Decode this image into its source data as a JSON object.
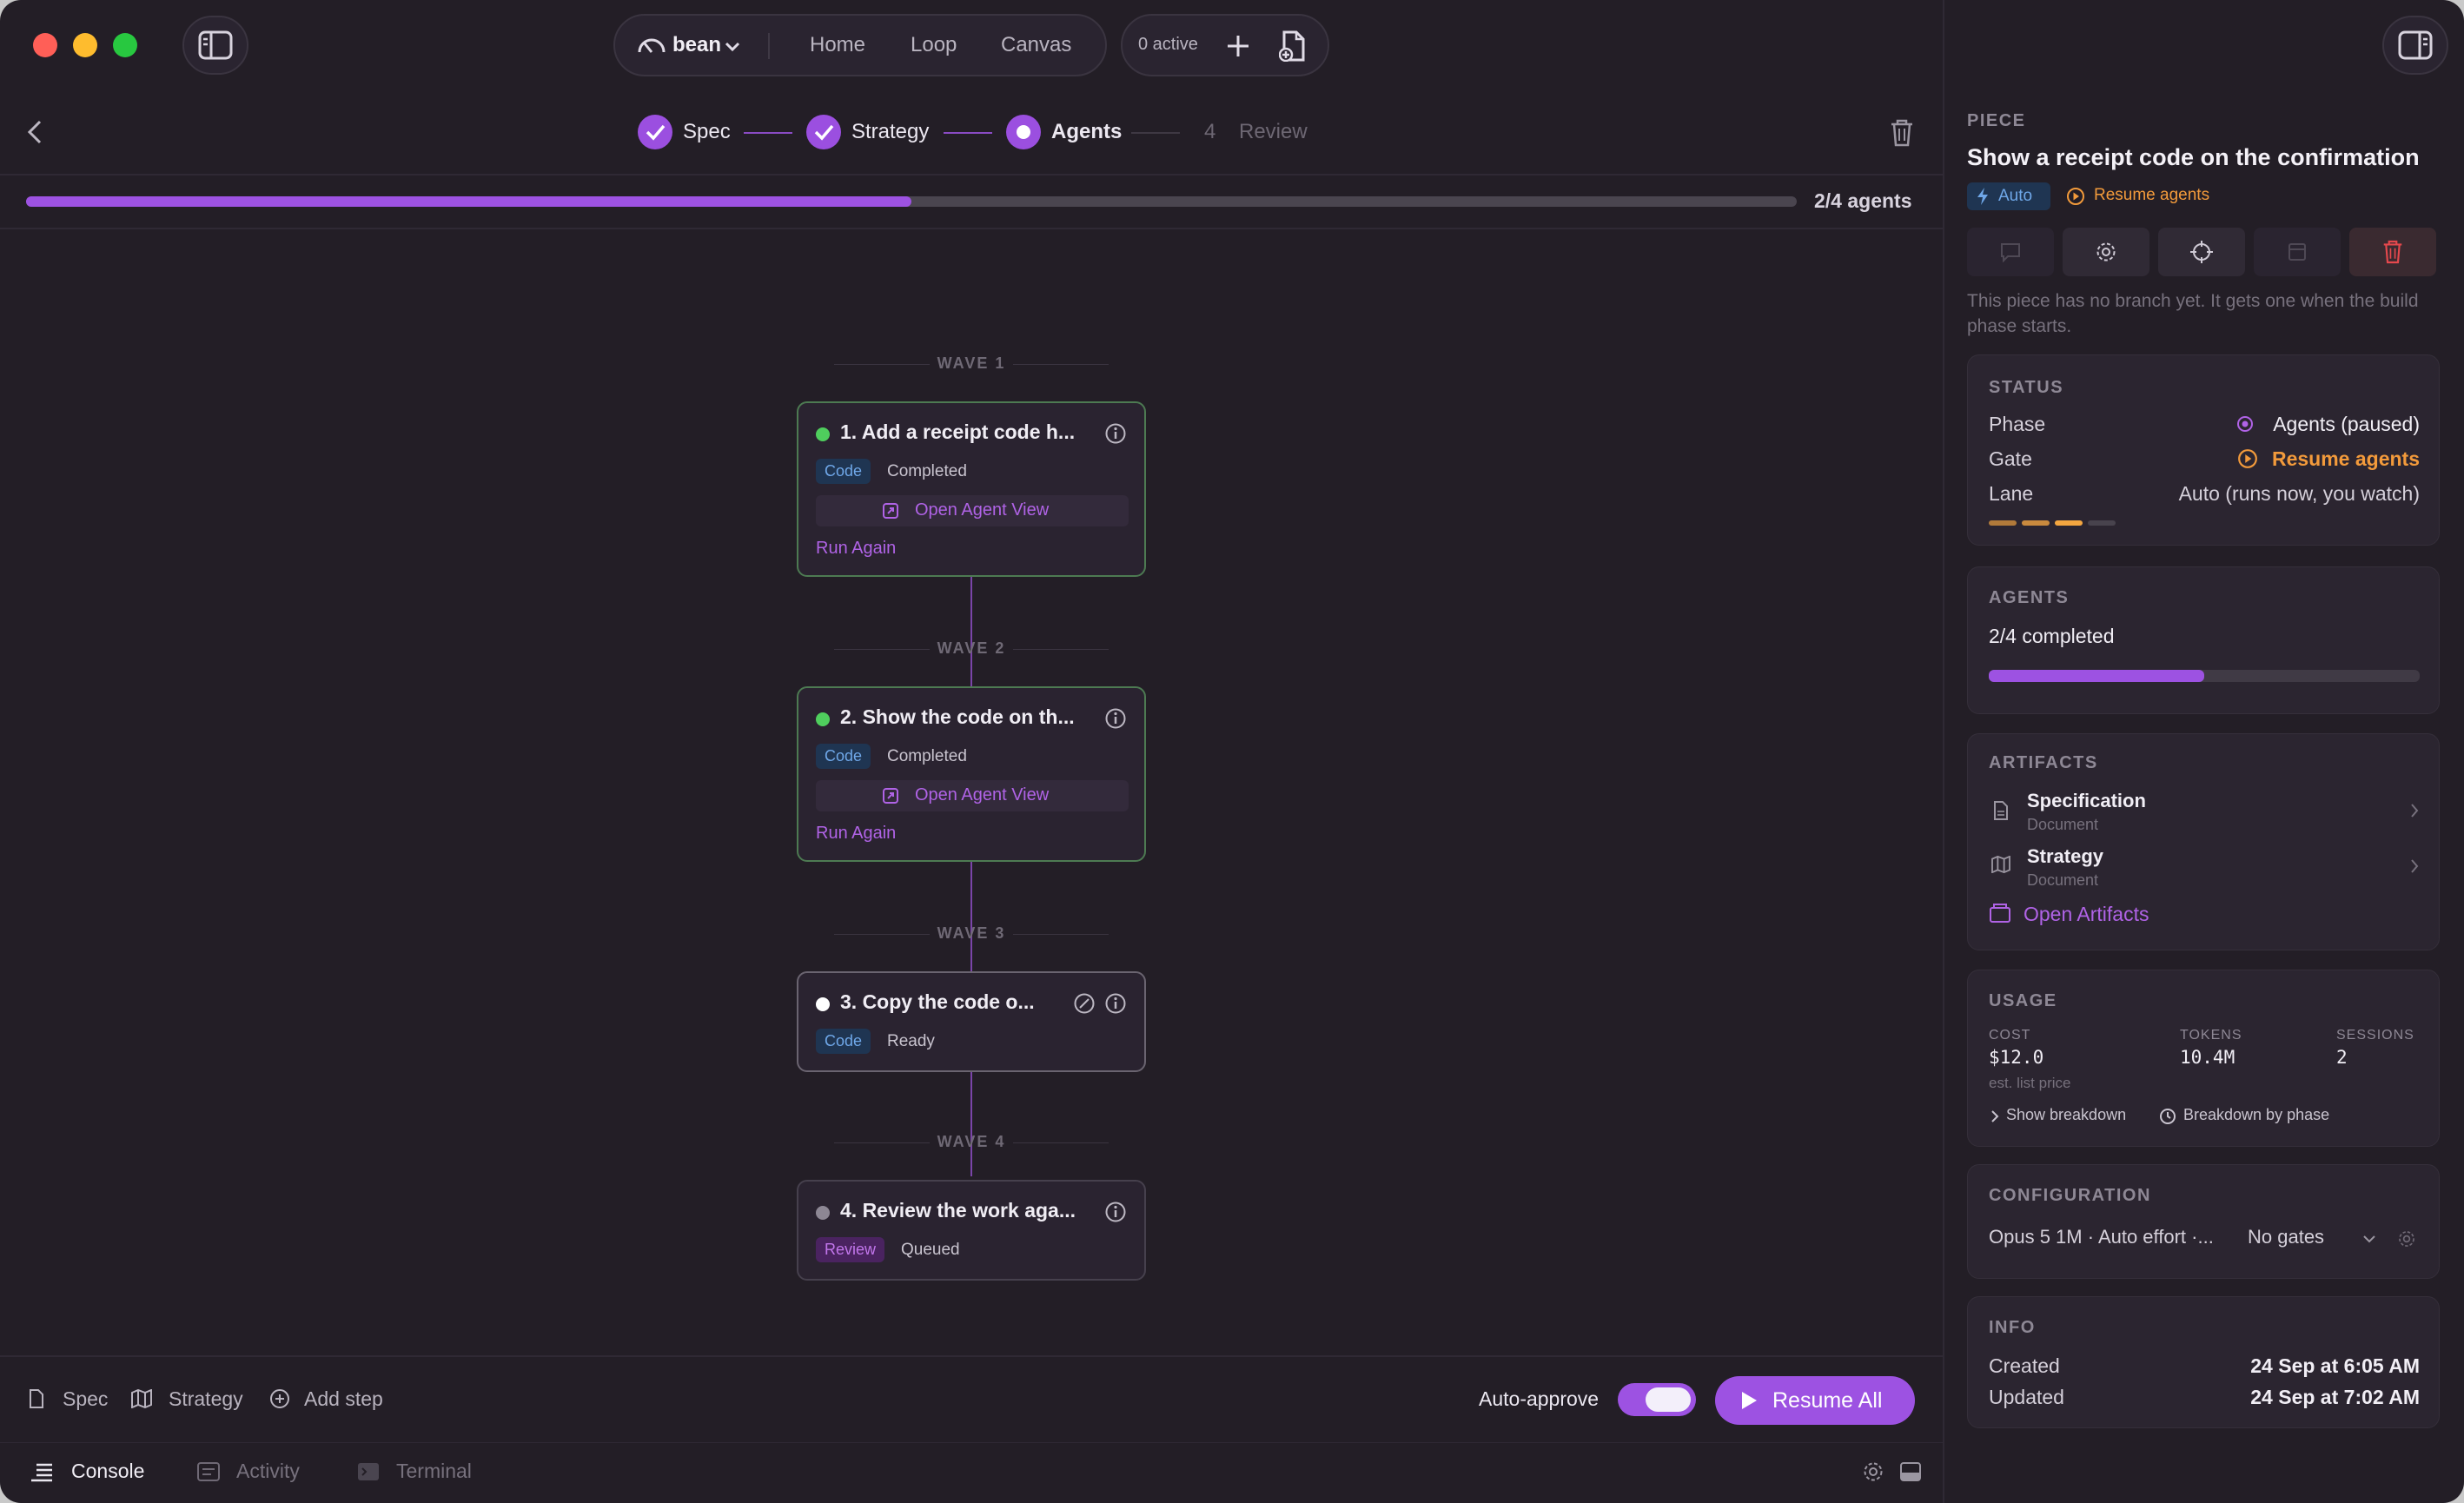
{
  "topbar": {
    "project": "bean",
    "nav": [
      "Home",
      "Loop",
      "Canvas"
    ],
    "active_count": "0 active"
  },
  "stepper": {
    "steps": [
      {
        "label": "Spec",
        "state": "done"
      },
      {
        "label": "Strategy",
        "state": "done"
      },
      {
        "label": "Agents",
        "state": "current"
      },
      {
        "label": "Review",
        "number": "4",
        "state": "pending"
      }
    ]
  },
  "progress": {
    "label": "2/4 agents",
    "fraction": 0.5
  },
  "canvas": {
    "waves": [
      "WAVE 1",
      "WAVE 2",
      "WAVE 3",
      "WAVE 4"
    ],
    "cards": [
      {
        "title": "1. Add a receipt code h...",
        "tag": "Code",
        "status": "Completed",
        "open_label": "Open Agent View",
        "run_label": "Run Again",
        "dot": "#4fce5d"
      },
      {
        "title": "2. Show the code on th...",
        "tag": "Code",
        "status": "Completed",
        "open_label": "Open Agent View",
        "run_label": "Run Again",
        "dot": "#4fce5d"
      },
      {
        "title": "3. Copy the code o...",
        "tag": "Code",
        "status": "Ready",
        "dot": "#ffffff"
      },
      {
        "title": "4. Review the work aga...",
        "tag": "Review",
        "status": "Queued",
        "dot": "#8d8794"
      }
    ]
  },
  "footer": {
    "spec": "Spec",
    "strategy": "Strategy",
    "add_step": "Add step",
    "auto_approve": "Auto-approve",
    "resume_all": "Resume All"
  },
  "tabs": [
    "Console",
    "Activity",
    "Terminal"
  ],
  "panel": {
    "kicker": "PIECE",
    "title": "Show a receipt code on the confirmation",
    "auto_badge": "Auto",
    "resume_link": "Resume agents",
    "branch_note": "This piece has no branch yet. It gets one when the build phase starts.",
    "status": {
      "title": "STATUS",
      "phase_label": "Phase",
      "phase_value": "Agents (paused)",
      "gate_label": "Gate",
      "gate_value": "Resume agents",
      "lane_label": "Lane",
      "lane_value": "Auto (runs now, you watch)"
    },
    "agents": {
      "title": "AGENTS",
      "summary": "2/4 completed",
      "fraction": 0.5
    },
    "artifacts": {
      "title": "ARTIFACTS",
      "items": [
        {
          "name": "Specification",
          "type": "Document"
        },
        {
          "name": "Strategy",
          "type": "Document"
        }
      ],
      "open_label": "Open Artifacts"
    },
    "usage": {
      "title": "USAGE",
      "cost_label": "COST",
      "cost_value": "$12.0",
      "cost_note": "est. list price",
      "tokens_label": "TOKENS",
      "tokens_value": "10.4M",
      "sessions_label": "SESSIONS",
      "sessions_value": "2",
      "show_breakdown": "Show breakdown",
      "by_phase": "Breakdown by phase"
    },
    "configuration": {
      "title": "CONFIGURATION",
      "summary": "Opus 5 1M · Auto effort ·...",
      "gates": "No gates"
    },
    "info": {
      "title": "INFO",
      "created_label": "Created",
      "created_value": "24 Sep at 6:05 AM",
      "updated_label": "Updated",
      "updated_value": "24 Sep at 7:02 AM"
    }
  },
  "colors": {
    "accent": "#9d52e2",
    "success": "#4fce5d",
    "warning": "#f29a3b",
    "danger": "#e5484d"
  }
}
